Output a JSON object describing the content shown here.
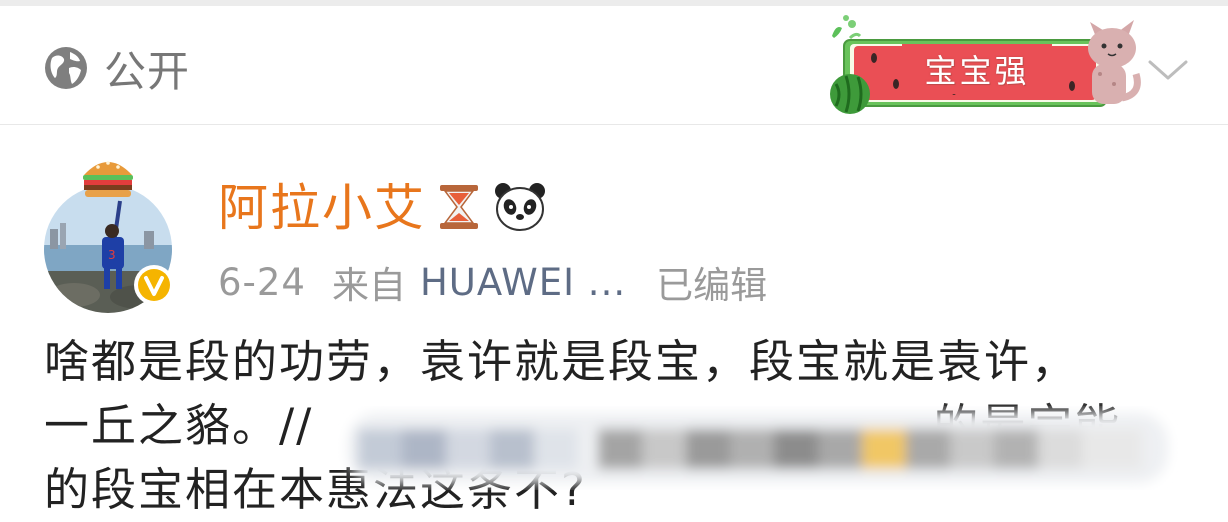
{
  "visibility": {
    "label": "公开",
    "icon": "globe-icon"
  },
  "badge": {
    "text": "宝宝强",
    "icon": "watermelon-cat-badge"
  },
  "post": {
    "author": {
      "name": "阿拉小艾",
      "emojis": [
        "hourglass-emoji",
        "panda-emoji"
      ],
      "avatar_decoration": "hamburger",
      "verified_icon": "verified-v-icon"
    },
    "meta": {
      "date": "6-24",
      "source_prefix": "来自",
      "device": "HUAWEI ...",
      "edited": "已编辑"
    },
    "content": {
      "line1": "啥都是段的功劳，袁许就是段宝，段宝就是袁许，",
      "line2_prefix": "一丘之貉。//",
      "line2_suffix": "的最完能",
      "line3": "的段宝相在本惠法这条不?"
    }
  },
  "colors": {
    "accent": "#e8761c",
    "link": "#5e6c85",
    "text": "#222222",
    "muted": "#9a9a9a",
    "watermelon_red": "#ea4f55",
    "verified": "#f5b400"
  }
}
